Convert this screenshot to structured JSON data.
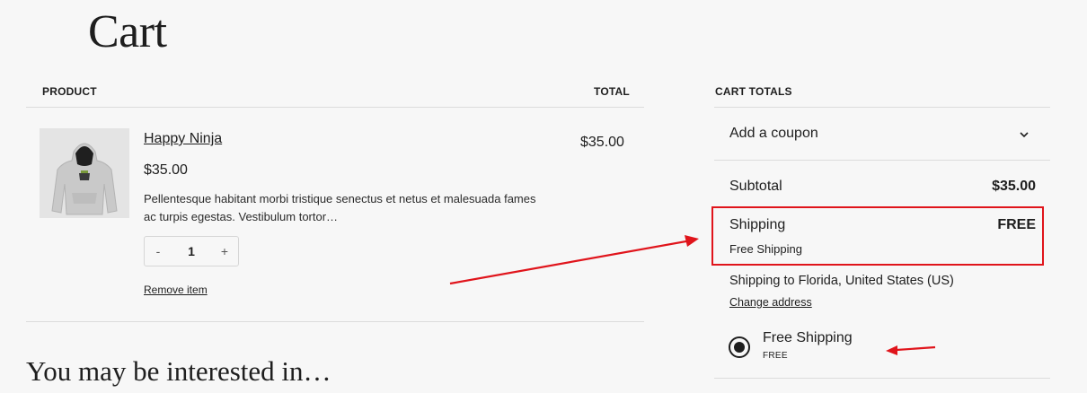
{
  "page": {
    "title": "Cart"
  },
  "cart": {
    "columns": {
      "product": "PRODUCT",
      "total": "TOTAL"
    },
    "items": [
      {
        "name": "Happy Ninja",
        "price": "$35.00",
        "description": "Pellentesque habitant morbi tristique senectus et netus et malesuada fames ac turpis egestas. Vestibulum tortor…",
        "quantity": "1",
        "decrement_label": "-",
        "increment_label": "+",
        "remove_label": "Remove item",
        "line_total": "$35.00",
        "image_icon": "hoodie-product-image"
      }
    ]
  },
  "cross_sells": {
    "heading": "You may be interested in…"
  },
  "totals": {
    "heading": "CART TOTALS",
    "coupon_label": "Add a coupon",
    "coupon_icon": "chevron-down-icon",
    "subtotal_label": "Subtotal",
    "subtotal_value": "$35.00",
    "shipping_label": "Shipping",
    "shipping_value": "FREE",
    "shipping_method": "Free Shipping",
    "shipping_to": "Shipping to Florida, United States (US)",
    "change_address": "Change address",
    "options": [
      {
        "label": "Free Shipping",
        "price": "FREE",
        "selected": true
      }
    ]
  },
  "annotations": {
    "highlight_color": "#e0141b"
  }
}
